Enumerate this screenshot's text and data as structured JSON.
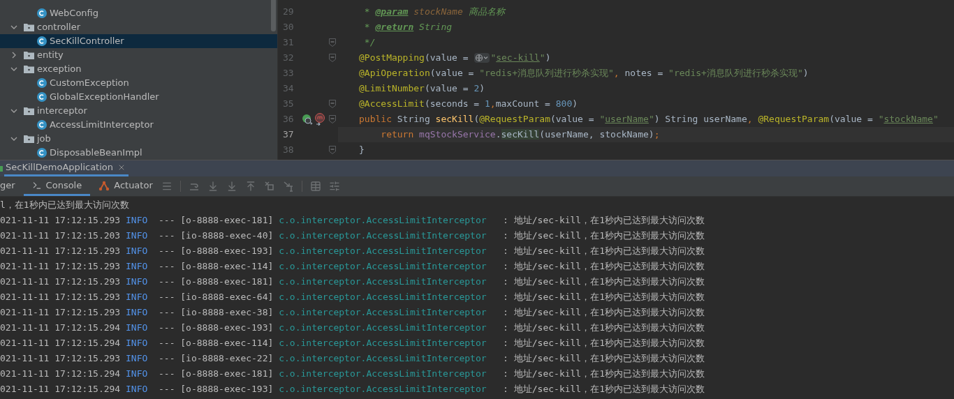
{
  "project_tree": {
    "leading_items": [
      {
        "name": "WebConfig",
        "kind": "class",
        "selected": false
      }
    ],
    "folders": [
      {
        "name": "controller",
        "expanded": true,
        "selected": false,
        "children": [
          {
            "name": "SecKillController",
            "kind": "class",
            "selected": true
          }
        ]
      },
      {
        "name": "entity",
        "expanded": false,
        "selected": false
      },
      {
        "name": "exception",
        "expanded": true,
        "selected": false,
        "children": [
          {
            "name": "CustomException",
            "kind": "class",
            "selected": false
          },
          {
            "name": "GlobalExceptionHandler",
            "kind": "class",
            "selected": false
          }
        ]
      },
      {
        "name": "interceptor",
        "expanded": true,
        "selected": false,
        "children": [
          {
            "name": "AccessLimitInterceptor",
            "kind": "class",
            "selected": false
          }
        ]
      },
      {
        "name": "job",
        "expanded": true,
        "selected": false,
        "children": [
          {
            "name": "DisposableBeanImpl",
            "kind": "class",
            "selected": false
          }
        ]
      }
    ]
  },
  "editor": {
    "lines": [
      {
        "number": "29",
        "current": false,
        "tokens": [
          {
            "kind": "doc",
            "text": " * "
          },
          {
            "kind": "doc_tag",
            "text": "@param"
          },
          {
            "kind": "doc_param",
            "text": " stockName"
          },
          {
            "kind": "doc",
            "text": " 商品名称"
          }
        ]
      },
      {
        "number": "30",
        "current": false,
        "tokens": [
          {
            "kind": "doc",
            "text": " * "
          },
          {
            "kind": "doc_tag",
            "text": "@return"
          },
          {
            "kind": "doc",
            "text": " String"
          }
        ]
      },
      {
        "number": "31",
        "current": false,
        "fold": true,
        "tokens": [
          {
            "kind": "doc",
            "text": " */"
          }
        ]
      },
      {
        "number": "32",
        "current": false,
        "fold": true,
        "tokens": [
          {
            "kind": "annotation",
            "text": "@PostMapping"
          },
          {
            "kind": "plain",
            "text": "(value = "
          },
          {
            "kind": "inlay"
          },
          {
            "kind": "string",
            "text": "\""
          },
          {
            "kind": "link",
            "text": "sec-kill"
          },
          {
            "kind": "string",
            "text": "\""
          },
          {
            "kind": "plain",
            "text": ")"
          }
        ]
      },
      {
        "number": "33",
        "current": false,
        "tokens": [
          {
            "kind": "annotation",
            "text": "@ApiOperation"
          },
          {
            "kind": "plain",
            "text": "(value = "
          },
          {
            "kind": "string",
            "text": "\"redis+消息队列进行秒杀实现\""
          },
          {
            "kind": "keyword",
            "text": ","
          },
          {
            "kind": "plain",
            "text": " notes = "
          },
          {
            "kind": "string",
            "text": "\"redis+消息队列进行秒杀实现\""
          },
          {
            "kind": "plain",
            "text": ")"
          }
        ]
      },
      {
        "number": "34",
        "current": false,
        "tokens": [
          {
            "kind": "annotation",
            "text": "@LimitNumber"
          },
          {
            "kind": "plain",
            "text": "(value = "
          },
          {
            "kind": "number",
            "text": "2"
          },
          {
            "kind": "plain",
            "text": ")"
          }
        ]
      },
      {
        "number": "35",
        "current": false,
        "fold": true,
        "tokens": [
          {
            "kind": "annotation",
            "text": "@AccessLimit"
          },
          {
            "kind": "plain",
            "text": "(seconds = "
          },
          {
            "kind": "number",
            "text": "1"
          },
          {
            "kind": "keyword",
            "text": ","
          },
          {
            "kind": "plain",
            "text": "maxCount = "
          },
          {
            "kind": "number",
            "text": "800"
          },
          {
            "kind": "plain",
            "text": ")"
          }
        ]
      },
      {
        "number": "36",
        "current": false,
        "fold": true,
        "markers": true,
        "tokens": [
          {
            "kind": "keyword",
            "text": "public"
          },
          {
            "kind": "plain",
            "text": " String "
          },
          {
            "kind": "method",
            "text": "secKill"
          },
          {
            "kind": "plain",
            "text": "("
          },
          {
            "kind": "annotation",
            "text": "@RequestParam"
          },
          {
            "kind": "plain",
            "text": "(value = "
          },
          {
            "kind": "string",
            "text": "\""
          },
          {
            "kind": "link",
            "text": "userName"
          },
          {
            "kind": "string",
            "text": "\""
          },
          {
            "kind": "plain",
            "text": ") String userName"
          },
          {
            "kind": "keyword",
            "text": ","
          },
          {
            "kind": "annotation",
            "text": " @RequestParam"
          },
          {
            "kind": "plain",
            "text": "(value = "
          },
          {
            "kind": "string",
            "text": "\""
          },
          {
            "kind": "link",
            "text": "stockName"
          },
          {
            "kind": "string",
            "text": "\""
          }
        ]
      },
      {
        "number": "37",
        "current": true,
        "tokens": [
          {
            "kind": "keyword",
            "text": "    return"
          },
          {
            "kind": "field",
            "text": " mqStockService"
          },
          {
            "kind": "plain",
            "text": "."
          },
          {
            "kind": "match",
            "text": "secKill"
          },
          {
            "kind": "plain",
            "text": "(userName, stockName)"
          },
          {
            "kind": "keyword",
            "text": ";"
          }
        ]
      },
      {
        "number": "38",
        "current": false,
        "fold": true,
        "tokens": [
          {
            "kind": "plain",
            "text": "}"
          }
        ]
      }
    ]
  },
  "run_tabs": [
    {
      "label": "SecKillDemoApplication",
      "selected": true
    }
  ],
  "console_tabs": [
    {
      "label": "ger",
      "kind": "plain",
      "selected": false
    },
    {
      "label": "Console",
      "kind": "console",
      "selected": true
    },
    {
      "label": "Actuator",
      "kind": "actuator",
      "selected": false
    }
  ],
  "console": {
    "first_line": "l，在1秒内已达到最大访问次数",
    "log_lines": [
      {
        "time": "021-11-11 17:12:15.293",
        "level": "INFO",
        "dashes": "---",
        "thread": "[o-8888-exec-181]",
        "logger": "c.o.interceptor.AccessLimitInterceptor",
        "colon": ":",
        "message": "地址/sec-kill，在1秒内已达到最大访问次数"
      },
      {
        "time": "021-11-11 17:12:15.203",
        "level": "INFO",
        "dashes": "---",
        "thread": "[io-8888-exec-40]",
        "logger": "c.o.interceptor.AccessLimitInterceptor",
        "colon": ":",
        "message": "地址/sec-kill，在1秒内已达到最大访问次数"
      },
      {
        "time": "021-11-11 17:12:15.293",
        "level": "INFO",
        "dashes": "---",
        "thread": "[o-8888-exec-193]",
        "logger": "c.o.interceptor.AccessLimitInterceptor",
        "colon": ":",
        "message": "地址/sec-kill，在1秒内已达到最大访问次数"
      },
      {
        "time": "021-11-11 17:12:15.293",
        "level": "INFO",
        "dashes": "---",
        "thread": "[o-8888-exec-114]",
        "logger": "c.o.interceptor.AccessLimitInterceptor",
        "colon": ":",
        "message": "地址/sec-kill，在1秒内已达到最大访问次数"
      },
      {
        "time": "021-11-11 17:12:15.293",
        "level": "INFO",
        "dashes": "---",
        "thread": "[o-8888-exec-181]",
        "logger": "c.o.interceptor.AccessLimitInterceptor",
        "colon": ":",
        "message": "地址/sec-kill，在1秒内已达到最大访问次数"
      },
      {
        "time": "021-11-11 17:12:15.293",
        "level": "INFO",
        "dashes": "---",
        "thread": "[io-8888-exec-64]",
        "logger": "c.o.interceptor.AccessLimitInterceptor",
        "colon": ":",
        "message": "地址/sec-kill，在1秒内已达到最大访问次数"
      },
      {
        "time": "021-11-11 17:12:15.293",
        "level": "INFO",
        "dashes": "---",
        "thread": "[io-8888-exec-38]",
        "logger": "c.o.interceptor.AccessLimitInterceptor",
        "colon": ":",
        "message": "地址/sec-kill，在1秒内已达到最大访问次数"
      },
      {
        "time": "021-11-11 17:12:15.294",
        "level": "INFO",
        "dashes": "---",
        "thread": "[o-8888-exec-193]",
        "logger": "c.o.interceptor.AccessLimitInterceptor",
        "colon": ":",
        "message": "地址/sec-kill，在1秒内已达到最大访问次数"
      },
      {
        "time": "021-11-11 17:12:15.294",
        "level": "INFO",
        "dashes": "---",
        "thread": "[o-8888-exec-114]",
        "logger": "c.o.interceptor.AccessLimitInterceptor",
        "colon": ":",
        "message": "地址/sec-kill，在1秒内已达到最大访问次数"
      },
      {
        "time": "021-11-11 17:12:15.293",
        "level": "INFO",
        "dashes": "---",
        "thread": "[io-8888-exec-22]",
        "logger": "c.o.interceptor.AccessLimitInterceptor",
        "colon": ":",
        "message": "地址/sec-kill，在1秒内已达到最大访问次数"
      },
      {
        "time": "021-11-11 17:12:15.294",
        "level": "INFO",
        "dashes": "---",
        "thread": "[o-8888-exec-181]",
        "logger": "c.o.interceptor.AccessLimitInterceptor",
        "colon": ":",
        "message": "地址/sec-kill，在1秒内已达到最大访问次数"
      },
      {
        "time": "021-11-11 17:12:15.294",
        "level": "INFO",
        "dashes": "---",
        "thread": "[o-8888-exec-193]",
        "logger": "c.o.interceptor.AccessLimitInterceptor",
        "colon": ":",
        "message": "地址/sec-kill，在1秒内已达到最大访问次数"
      }
    ]
  }
}
